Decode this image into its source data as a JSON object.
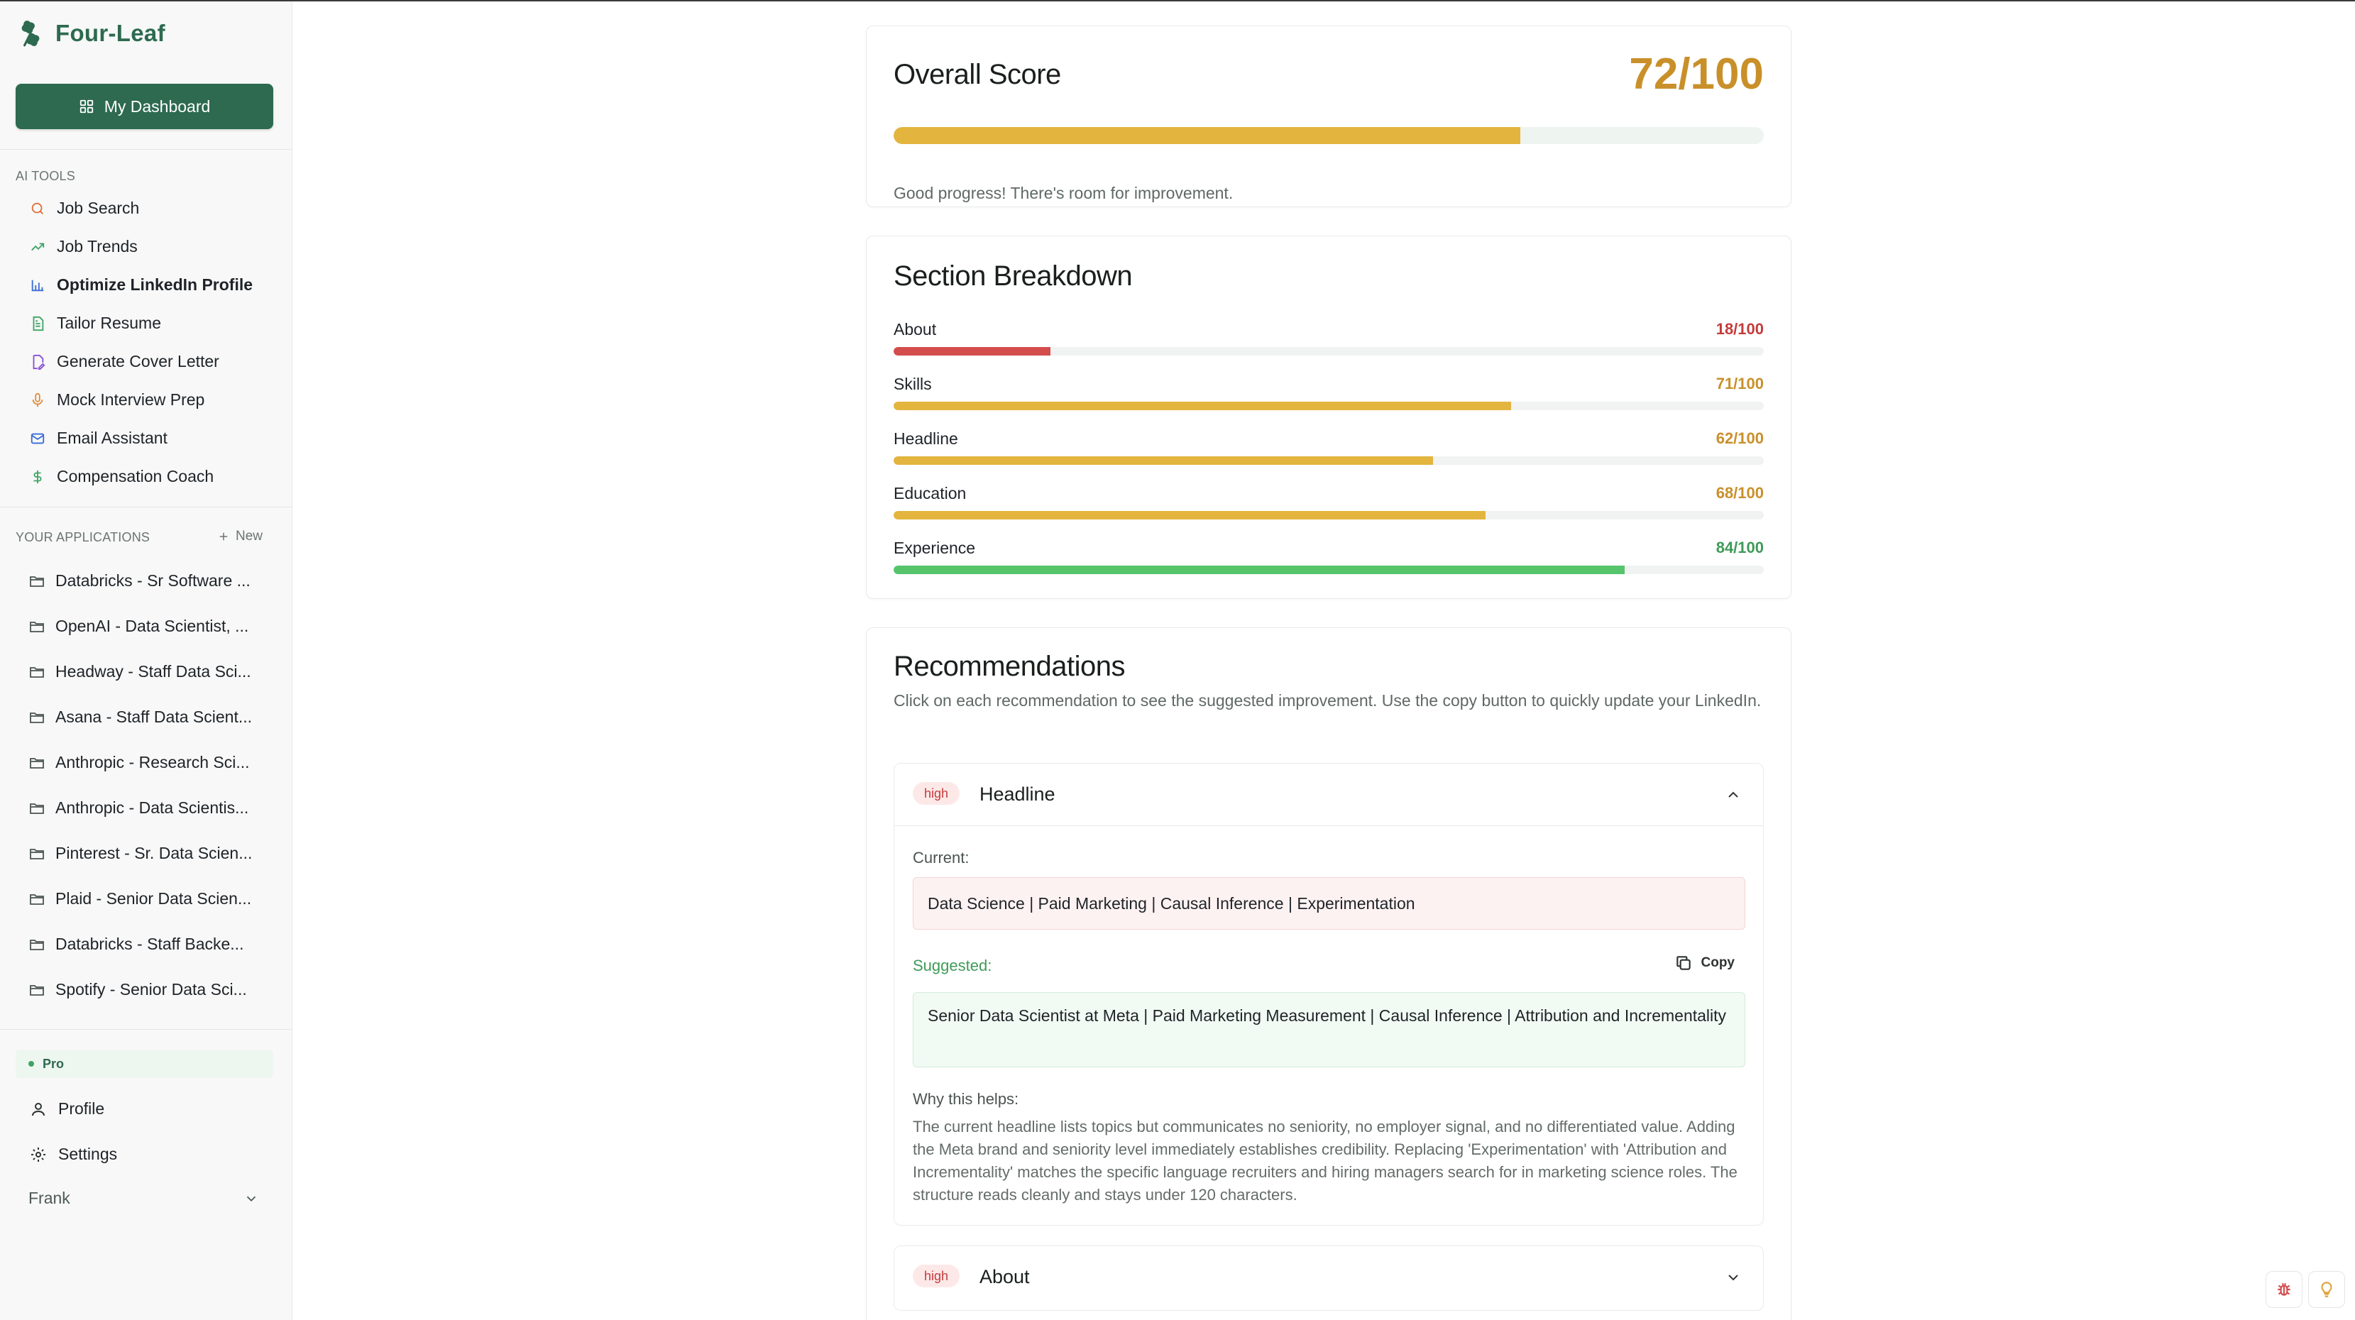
{
  "app": {
    "name": "Four-Leaf"
  },
  "sidebar": {
    "dashboard_label": "My Dashboard",
    "ai_tools_label": "AI TOOLS",
    "tools": [
      {
        "label": "Job Search",
        "icon": "search-icon",
        "color": "#e0703a"
      },
      {
        "label": "Job Trends",
        "icon": "trending-up-icon",
        "color": "#40a366"
      },
      {
        "label": "Optimize LinkedIn Profile",
        "icon": "bar-chart-icon",
        "color": "#3a6bd6"
      },
      {
        "label": "Tailor Resume",
        "icon": "document-icon",
        "color": "#40a366"
      },
      {
        "label": "Generate Cover Letter",
        "icon": "file-pen-icon",
        "color": "#8a4fd6"
      },
      {
        "label": "Mock Interview Prep",
        "icon": "microphone-icon",
        "color": "#e08a3a"
      },
      {
        "label": "Email Assistant",
        "icon": "mail-icon",
        "color": "#3a6bd6"
      },
      {
        "label": "Compensation Coach",
        "icon": "dollar-icon",
        "color": "#40a366"
      }
    ],
    "applications_label": "YOUR APPLICATIONS",
    "new_label": "New",
    "applications": [
      "Databricks - Sr Software ...",
      "OpenAI - Data Scientist, ...",
      "Headway - Staff Data Sci...",
      "Asana - Staff Data Scient...",
      "Anthropic - Research Sci...",
      "Anthropic - Data Scientis...",
      "Pinterest - Sr. Data Scien...",
      "Plaid - Senior Data Scien...",
      "Databricks - Staff Backe...",
      "Spotify - Senior Data Sci..."
    ],
    "plan_label": "Pro",
    "profile_label": "Profile",
    "settings_label": "Settings",
    "user_name": "Frank"
  },
  "overall": {
    "title": "Overall Score",
    "score_text": "72/100",
    "score": 72,
    "message": "Good progress! There's room for improvement."
  },
  "breakdown": {
    "title": "Section Breakdown",
    "sections": [
      {
        "name": "About",
        "score_text": "18/100",
        "score": 18,
        "color": "#d34d4d",
        "text_color": "#c43b3b"
      },
      {
        "name": "Skills",
        "score_text": "71/100",
        "score": 71,
        "color": "#e3b53f",
        "text_color": "#c9902a"
      },
      {
        "name": "Headline",
        "score_text": "62/100",
        "score": 62,
        "color": "#e3b53f",
        "text_color": "#c9902a"
      },
      {
        "name": "Education",
        "score_text": "68/100",
        "score": 68,
        "color": "#e3b53f",
        "text_color": "#c9902a"
      },
      {
        "name": "Experience",
        "score_text": "84/100",
        "score": 84,
        "color": "#55c46b",
        "text_color": "#3f9a58"
      }
    ]
  },
  "recommendations": {
    "title": "Recommendations",
    "description": "Click on each recommendation to see the suggested improvement. Use the copy button to quickly update your LinkedIn.",
    "items": [
      {
        "priority": "high",
        "name": "Headline",
        "current_label": "Current:",
        "current": "Data Science | Paid Marketing | Causal Inference | Experimentation",
        "suggested_label": "Suggested:",
        "copy_label": "Copy",
        "suggested": "Senior Data Scientist at Meta | Paid Marketing Measurement | Causal Inference | Attribution and Incrementality",
        "why_label": "Why this helps:",
        "why": "The current headline lists topics but communicates no seniority, no employer signal, and no differentiated value. Adding the Meta brand and seniority level immediately establishes credibility. Replacing 'Experimentation' with 'Attribution and Incrementality' matches the specific language recruiters and hiring managers search for in marketing science roles. The structure reads cleanly and stays under 120 characters."
      },
      {
        "priority": "high",
        "name": "About"
      }
    ]
  }
}
